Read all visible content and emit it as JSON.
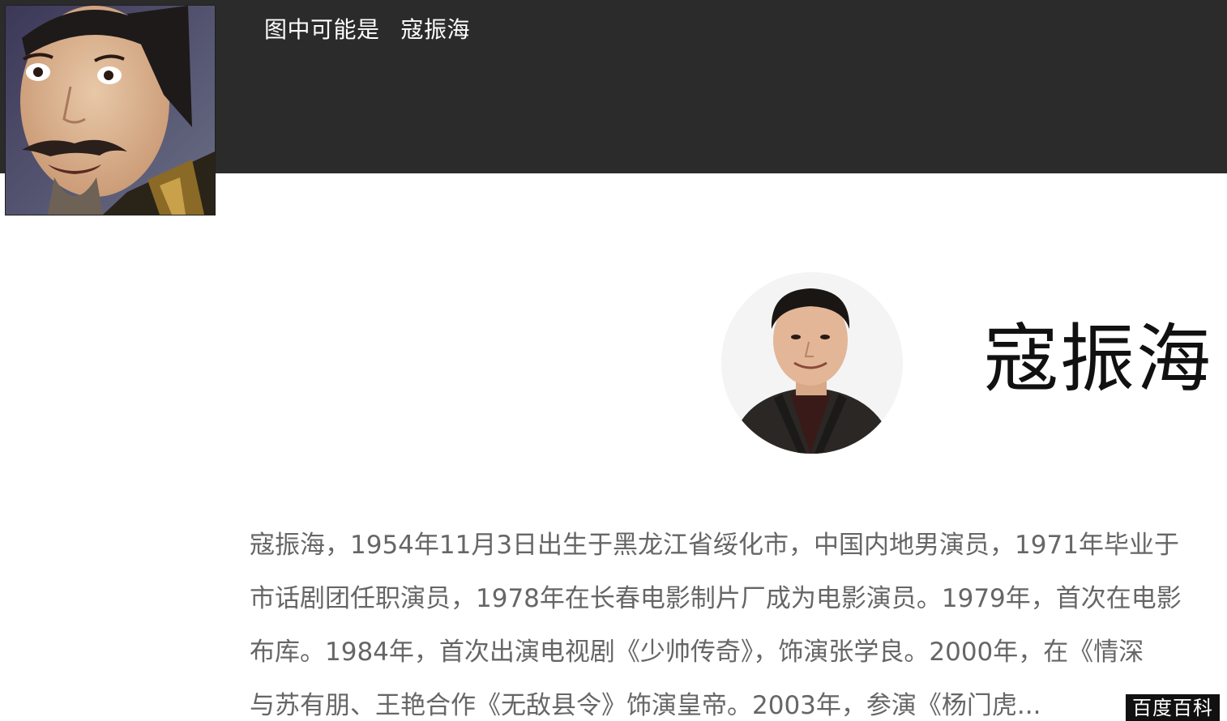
{
  "header": {
    "caption_prefix": "图中可能是",
    "caption_name": "寇振海"
  },
  "thumbnail": {
    "icon": "face-photo-thumbnail"
  },
  "profile": {
    "name": "寇振海",
    "avatar_icon": "portrait-avatar"
  },
  "bio": {
    "lines": [
      "寇振海，1954年11月3日出生于黑龙江省绥化市，中国内地男演员，1971年毕业于",
      "市话剧团任职演员，1978年在长春电影制片厂成为电影演员。1979年，首次在电影",
      "布库。1984年，首次出演电视剧《少帅传奇》，饰演张学良。2000年，在《情深",
      "与苏有朋、王艳合作《无敌县令》饰演皇帝。2003年，参演《杨门虎..."
    ]
  },
  "source": {
    "label": "百度百科"
  },
  "colors": {
    "header_bg": "#2b2b2b",
    "bio_text": "#666666",
    "badge_bg": "#111111"
  }
}
